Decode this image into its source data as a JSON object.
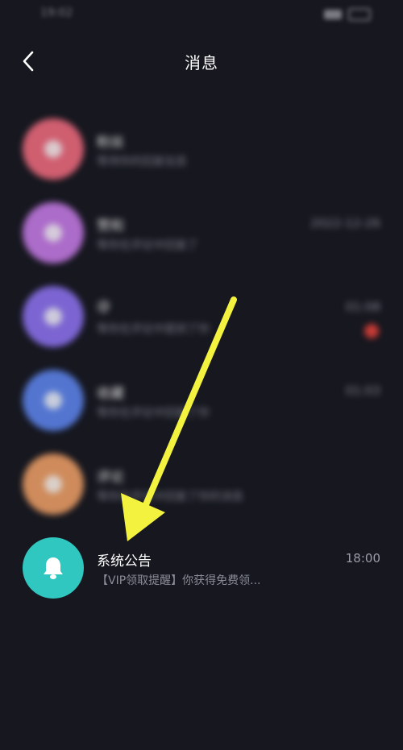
{
  "nav": {
    "title": "消息"
  },
  "status_bar": {
    "time": "19:02"
  },
  "messages": [
    {
      "title": "粉丝",
      "subtitle": "等待你的回复信息",
      "time": "",
      "color": "#f06b7e",
      "blurred": true
    },
    {
      "title": "赞和",
      "subtitle": "等你在评论中回复了",
      "time": "2022-12-26",
      "color": "#c77be8",
      "blurred": true
    },
    {
      "title": "@",
      "subtitle": "等你在评论中提到了你",
      "time": "01:08",
      "color": "#8e73f2",
      "blurred": true,
      "badge": true
    },
    {
      "title": "收藏",
      "subtitle": "等你在评论中回复了你",
      "time": "01:03",
      "color": "#5e86f0",
      "blurred": true
    },
    {
      "title": "评论",
      "subtitle": "等你在评论中回复了你的消息",
      "time": "",
      "color": "#f0a066",
      "blurred": true
    },
    {
      "title": "系统公告",
      "subtitle": "【VIP领取提醒】你获得免费领...",
      "time": "18:00",
      "color": "#2fc7c0",
      "blurred": false
    }
  ],
  "colors": {
    "background": "#16171f",
    "arrow": "#f3f23e"
  }
}
